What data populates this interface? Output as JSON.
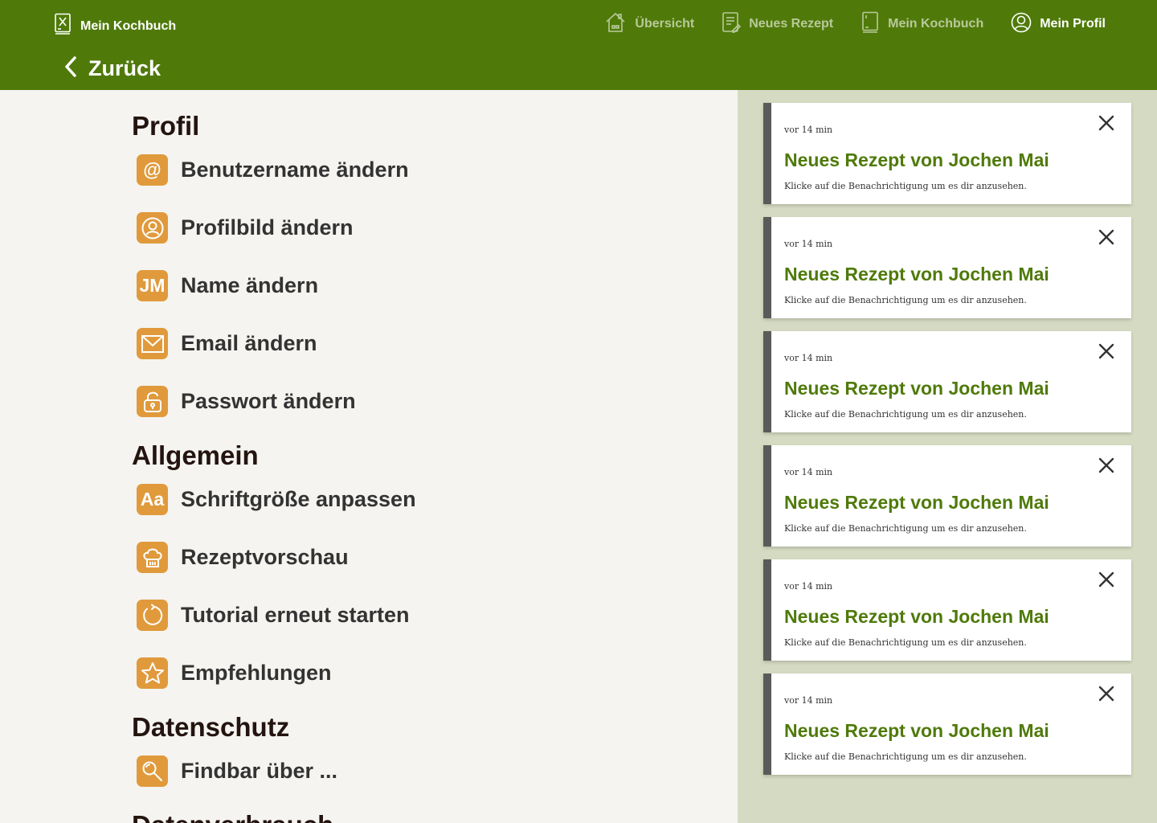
{
  "brand": {
    "title": "Mein Kochbuch"
  },
  "nav": {
    "items": [
      {
        "label": "Übersicht",
        "icon": "home-icon"
      },
      {
        "label": "Neues Rezept",
        "icon": "new-recipe-icon"
      },
      {
        "label": "Mein Kochbuch",
        "icon": "cookbook-icon"
      },
      {
        "label": "Mein Profil",
        "icon": "profile-icon",
        "active": true
      }
    ]
  },
  "back": {
    "label": "Zurück"
  },
  "settings": {
    "profil": {
      "title": "Profil",
      "items": [
        {
          "label": "Benutzername ändern",
          "icon": "at-icon",
          "icon_text": "@"
        },
        {
          "label": "Profilbild ändern",
          "icon": "user-circle-icon"
        },
        {
          "label": "Name ändern",
          "icon": "initials-icon",
          "icon_text": "JM"
        },
        {
          "label": "Email ändern",
          "icon": "mail-icon"
        },
        {
          "label": "Passwort ändern",
          "icon": "lock-icon"
        }
      ]
    },
    "allgemein": {
      "title": "Allgemein",
      "items": [
        {
          "label": "Schriftgröße anpassen",
          "icon": "font-size-icon",
          "icon_text": "Aa"
        },
        {
          "label": "Rezeptvorschau",
          "icon": "chef-hat-icon"
        },
        {
          "label": "Tutorial erneut starten",
          "icon": "restart-icon"
        },
        {
          "label": "Empfehlungen",
          "icon": "star-icon"
        }
      ]
    },
    "datenschutz": {
      "title": "Datenschutz",
      "items": [
        {
          "label": "Findbar über ...",
          "icon": "magnifier-icon"
        }
      ]
    },
    "datenverbrauch": {
      "title": "Datenverbrauch"
    }
  },
  "notifications": [
    {
      "time": "vor 14 min",
      "title": "Neues Rezept von Jochen Mai",
      "body": "Klicke auf die Benachrichtigung um es dir anzusehen."
    },
    {
      "time": "vor 14 min",
      "title": "Neues Rezept von Jochen Mai",
      "body": "Klicke auf die Benachrichtigung um es dir anzusehen."
    },
    {
      "time": "vor 14 min",
      "title": "Neues Rezept von Jochen Mai",
      "body": "Klicke auf die Benachrichtigung um es dir anzusehen."
    },
    {
      "time": "vor 14 min",
      "title": "Neues Rezept von Jochen Mai",
      "body": "Klicke auf die Benachrichtigung um es dir anzusehen."
    },
    {
      "time": "vor 14 min",
      "title": "Neues Rezept von Jochen Mai",
      "body": "Klicke auf die Benachrichtigung um es dir anzusehen."
    },
    {
      "time": "vor 14 min",
      "title": "Neues Rezept von Jochen Mai",
      "body": "Klicke auf die Benachrichtigung um es dir anzusehen."
    }
  ],
  "colors": {
    "header": "#4f7a0a",
    "accent_orange": "#e09a3c",
    "notification_panel": "#d5dbc2",
    "notification_title": "#4f7a0a"
  }
}
